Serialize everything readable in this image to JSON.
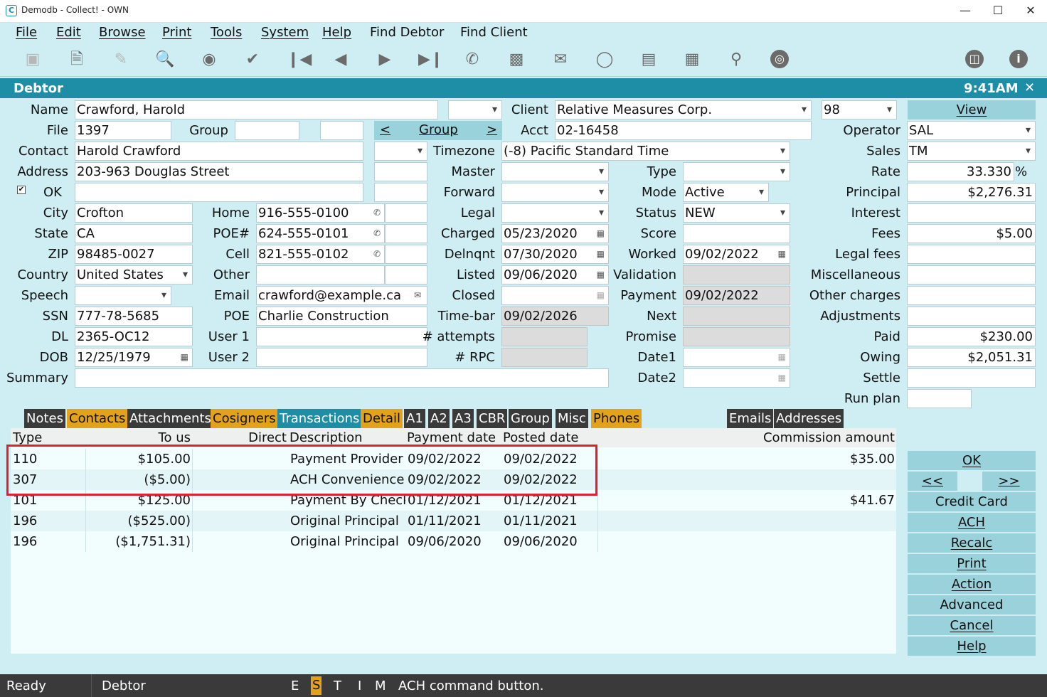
{
  "window": {
    "title": "Demodb - Collect! - OWN",
    "app_icon": "C",
    "minimize": "—",
    "maximize": "☐",
    "close": "✕"
  },
  "menu": [
    "File",
    "Edit",
    "Browse",
    "Print",
    "Tools",
    "System",
    "Help",
    "Find Debtor",
    "Find Client"
  ],
  "toolbar_icons": [
    "save-icon",
    "new-record-icon",
    "edit-record-icon",
    "search-record-icon",
    "binoculars-icon",
    "checkmark-icon",
    "first-record-icon",
    "previous-record-icon",
    "next-record-icon",
    "last-record-icon",
    "phone-icon",
    "printer-icon",
    "email-icon",
    "chat-icon",
    "credit-card-icon",
    "calendar-add-icon",
    "magnifier-icon",
    "globe-icon",
    "trash-icon",
    "info-icon"
  ],
  "header": {
    "title": "Debtor",
    "time": "9:41AM",
    "close": "✕"
  },
  "form": {
    "name_label": "Name",
    "name": "Crawford, Harold",
    "file_label": "File",
    "file": "1397",
    "group_label": "Group",
    "group_nav": {
      "prev": "<",
      "label": "Group",
      "next": ">"
    },
    "contact_label": "Contact",
    "contact": "Harold Crawford",
    "address_label": "Address",
    "address": "203-963 Douglas Street",
    "ok_check": "✔",
    "ok_label": "OK",
    "city_label": "City",
    "city": "Crofton",
    "state_label": "State",
    "state": "CA",
    "zip_label": "ZIP",
    "zip": "98485-0027",
    "country_label": "Country",
    "country": "United States",
    "speech_label": "Speech",
    "ssn_label": "SSN",
    "ssn": "777-78-5685",
    "dl_label": "DL",
    "dl": "2365-OC12",
    "dob_label": "DOB",
    "dob": "12/25/1979",
    "summary_label": "Summary",
    "home_label": "Home",
    "home": "916-555-0100",
    "poe_num_label": "POE#",
    "poe_num": "624-555-0101",
    "cell_label": "Cell",
    "cell": "821-555-0102",
    "other_label": "Other",
    "email_label": "Email",
    "email": "crawford@example.ca",
    "poe_label": "POE",
    "poe": "Charlie Construction",
    "user1_label": "User 1",
    "user2_label": "User 2",
    "client_label": "Client",
    "client": "Relative Measures Corp.",
    "client_num": "98",
    "acct_label": "Acct",
    "acct": "02-16458",
    "timezone_label": "Timezone",
    "timezone": "(-8) Pacific Standard Time",
    "master_label": "Master",
    "forward_label": "Forward",
    "legal_label": "Legal",
    "charged_label": "Charged",
    "charged": "05/23/2020",
    "delnqnt_label": "Delnqnt",
    "delnqnt": "07/30/2020",
    "listed_label": "Listed",
    "listed": "09/06/2020",
    "closed_label": "Closed",
    "timebar_label": "Time-bar",
    "timebar": "09/02/2026",
    "attempts_label": "# attempts",
    "rpc_label": "# RPC",
    "type_label": "Type",
    "mode_label": "Mode",
    "mode": "Active",
    "status_label": "Status",
    "status": "NEW",
    "score_label": "Score",
    "worked_label": "Worked",
    "worked": "09/02/2022",
    "validation_label": "Validation",
    "payment_label": "Payment",
    "payment": "09/02/2022",
    "next_label": "Next",
    "promise_label": "Promise",
    "date1_label": "Date1",
    "date2_label": "Date2",
    "view_label": "View",
    "operator_label": "Operator",
    "operator": "SAL",
    "sales_label": "Sales",
    "sales": "TM",
    "rate_label": "Rate",
    "rate": "33.330",
    "rate_unit": "%",
    "principal_label": "Principal",
    "principal": "$2,276.31",
    "interest_label": "Interest",
    "fees_label": "Fees",
    "fees": "$5.00",
    "legal_fees_label": "Legal fees",
    "misc_label": "Miscellaneous",
    "other_charges_label": "Other charges",
    "adjustments_label": "Adjustments",
    "paid_label": "Paid",
    "paid": "$230.00",
    "owing_label": "Owing",
    "owing": "$2,051.31",
    "settle_label": "Settle",
    "run_plan_label": "Run plan"
  },
  "tabs": [
    "Notes",
    "Contacts",
    "Attachments",
    "Cosigners",
    "Transactions",
    "Detail",
    "A1",
    "A2",
    "A3",
    "CBR",
    "Group",
    "Misc",
    "Phones",
    "Emails",
    "Addresses"
  ],
  "grid": {
    "headers": [
      "Type",
      "To us",
      "Direct",
      "Description",
      "Payment date",
      "Posted date",
      "Commission amount"
    ],
    "rows": [
      {
        "type": "110",
        "to_us": "$105.00",
        "desc": "Payment Provider A",
        "pay": "09/02/2022",
        "posted": "09/02/2022",
        "comm": "$35.00"
      },
      {
        "type": "307",
        "to_us": "($5.00)",
        "desc": "ACH Convenience F",
        "pay": "09/02/2022",
        "posted": "09/02/2022",
        "comm": ""
      },
      {
        "type": "101",
        "to_us": "$125.00",
        "desc": "Payment By Check",
        "pay": "01/12/2021",
        "posted": "01/12/2021",
        "comm": "$41.67"
      },
      {
        "type": "196",
        "to_us": "($525.00)",
        "desc": "Original Principal",
        "pay": "01/11/2021",
        "posted": "01/11/2021",
        "comm": ""
      },
      {
        "type": "196",
        "to_us": "($1,751.31)",
        "desc": "Original Principal",
        "pay": "09/06/2020",
        "posted": "09/06/2020",
        "comm": ""
      }
    ]
  },
  "side_buttons": {
    "ok": "OK",
    "prev": "<<",
    "next": ">>",
    "credit_card": "Credit Card",
    "ach": "ACH",
    "recalc": "Recalc",
    "print": "Print",
    "action": "Action",
    "advanced": "Advanced",
    "cancel": "Cancel",
    "help": "Help"
  },
  "status": {
    "ready": "Ready",
    "context": "Debtor",
    "flags": [
      "E",
      "S",
      "T",
      "I",
      "M"
    ],
    "message": "ACH command button."
  },
  "colors": {
    "header": "#1d8ea6",
    "background": "#cfeef4",
    "tab_dark": "#3a3a3a",
    "tab_orange": "#e4a11a",
    "button": "#9ad2dc",
    "highlight": "#e0202c"
  }
}
